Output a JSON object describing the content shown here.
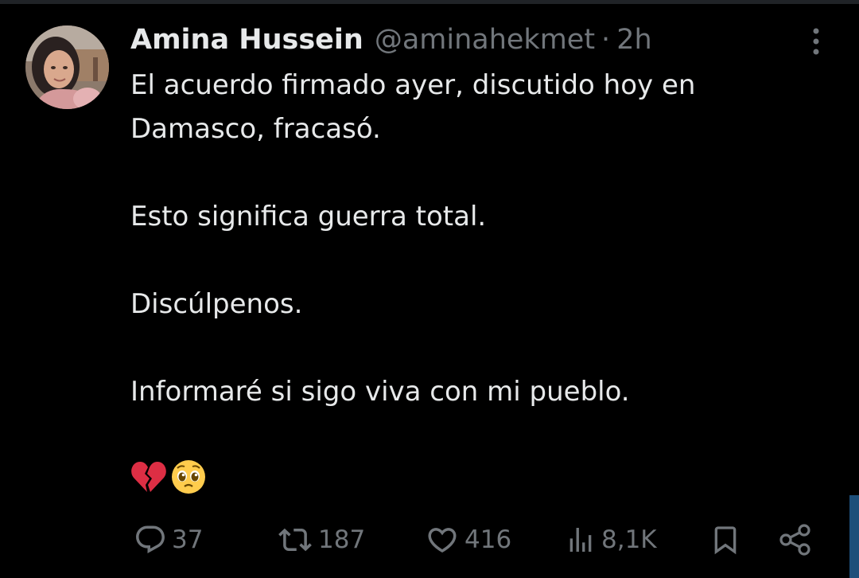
{
  "tweet": {
    "author_name": "Amina Hussein",
    "handle": "@aminahekmet",
    "separator": "·",
    "timestamp": "2h",
    "paragraphs": [
      "El acuerdo firmado ayer, discutido hoy en Damasco, fracasó.",
      "Esto significa guerra total.",
      "Discúlpenos.",
      "Informaré si sigo viva con mi pueblo."
    ],
    "emojis": [
      "broken-heart",
      "pleading-face"
    ]
  },
  "actions": {
    "replies": "37",
    "reposts": "187",
    "likes": "416",
    "views": "8,1K"
  },
  "icons": {
    "more": "more-vertical-icon",
    "reply": "reply-icon",
    "repost": "repost-icon",
    "like": "heart-icon",
    "views": "views-icon",
    "bookmark": "bookmark-icon",
    "share": "share-icon"
  },
  "colors": {
    "background": "#000000",
    "text": "#e7e9ea",
    "muted": "#71767b",
    "accent": "#1d4f7a"
  }
}
